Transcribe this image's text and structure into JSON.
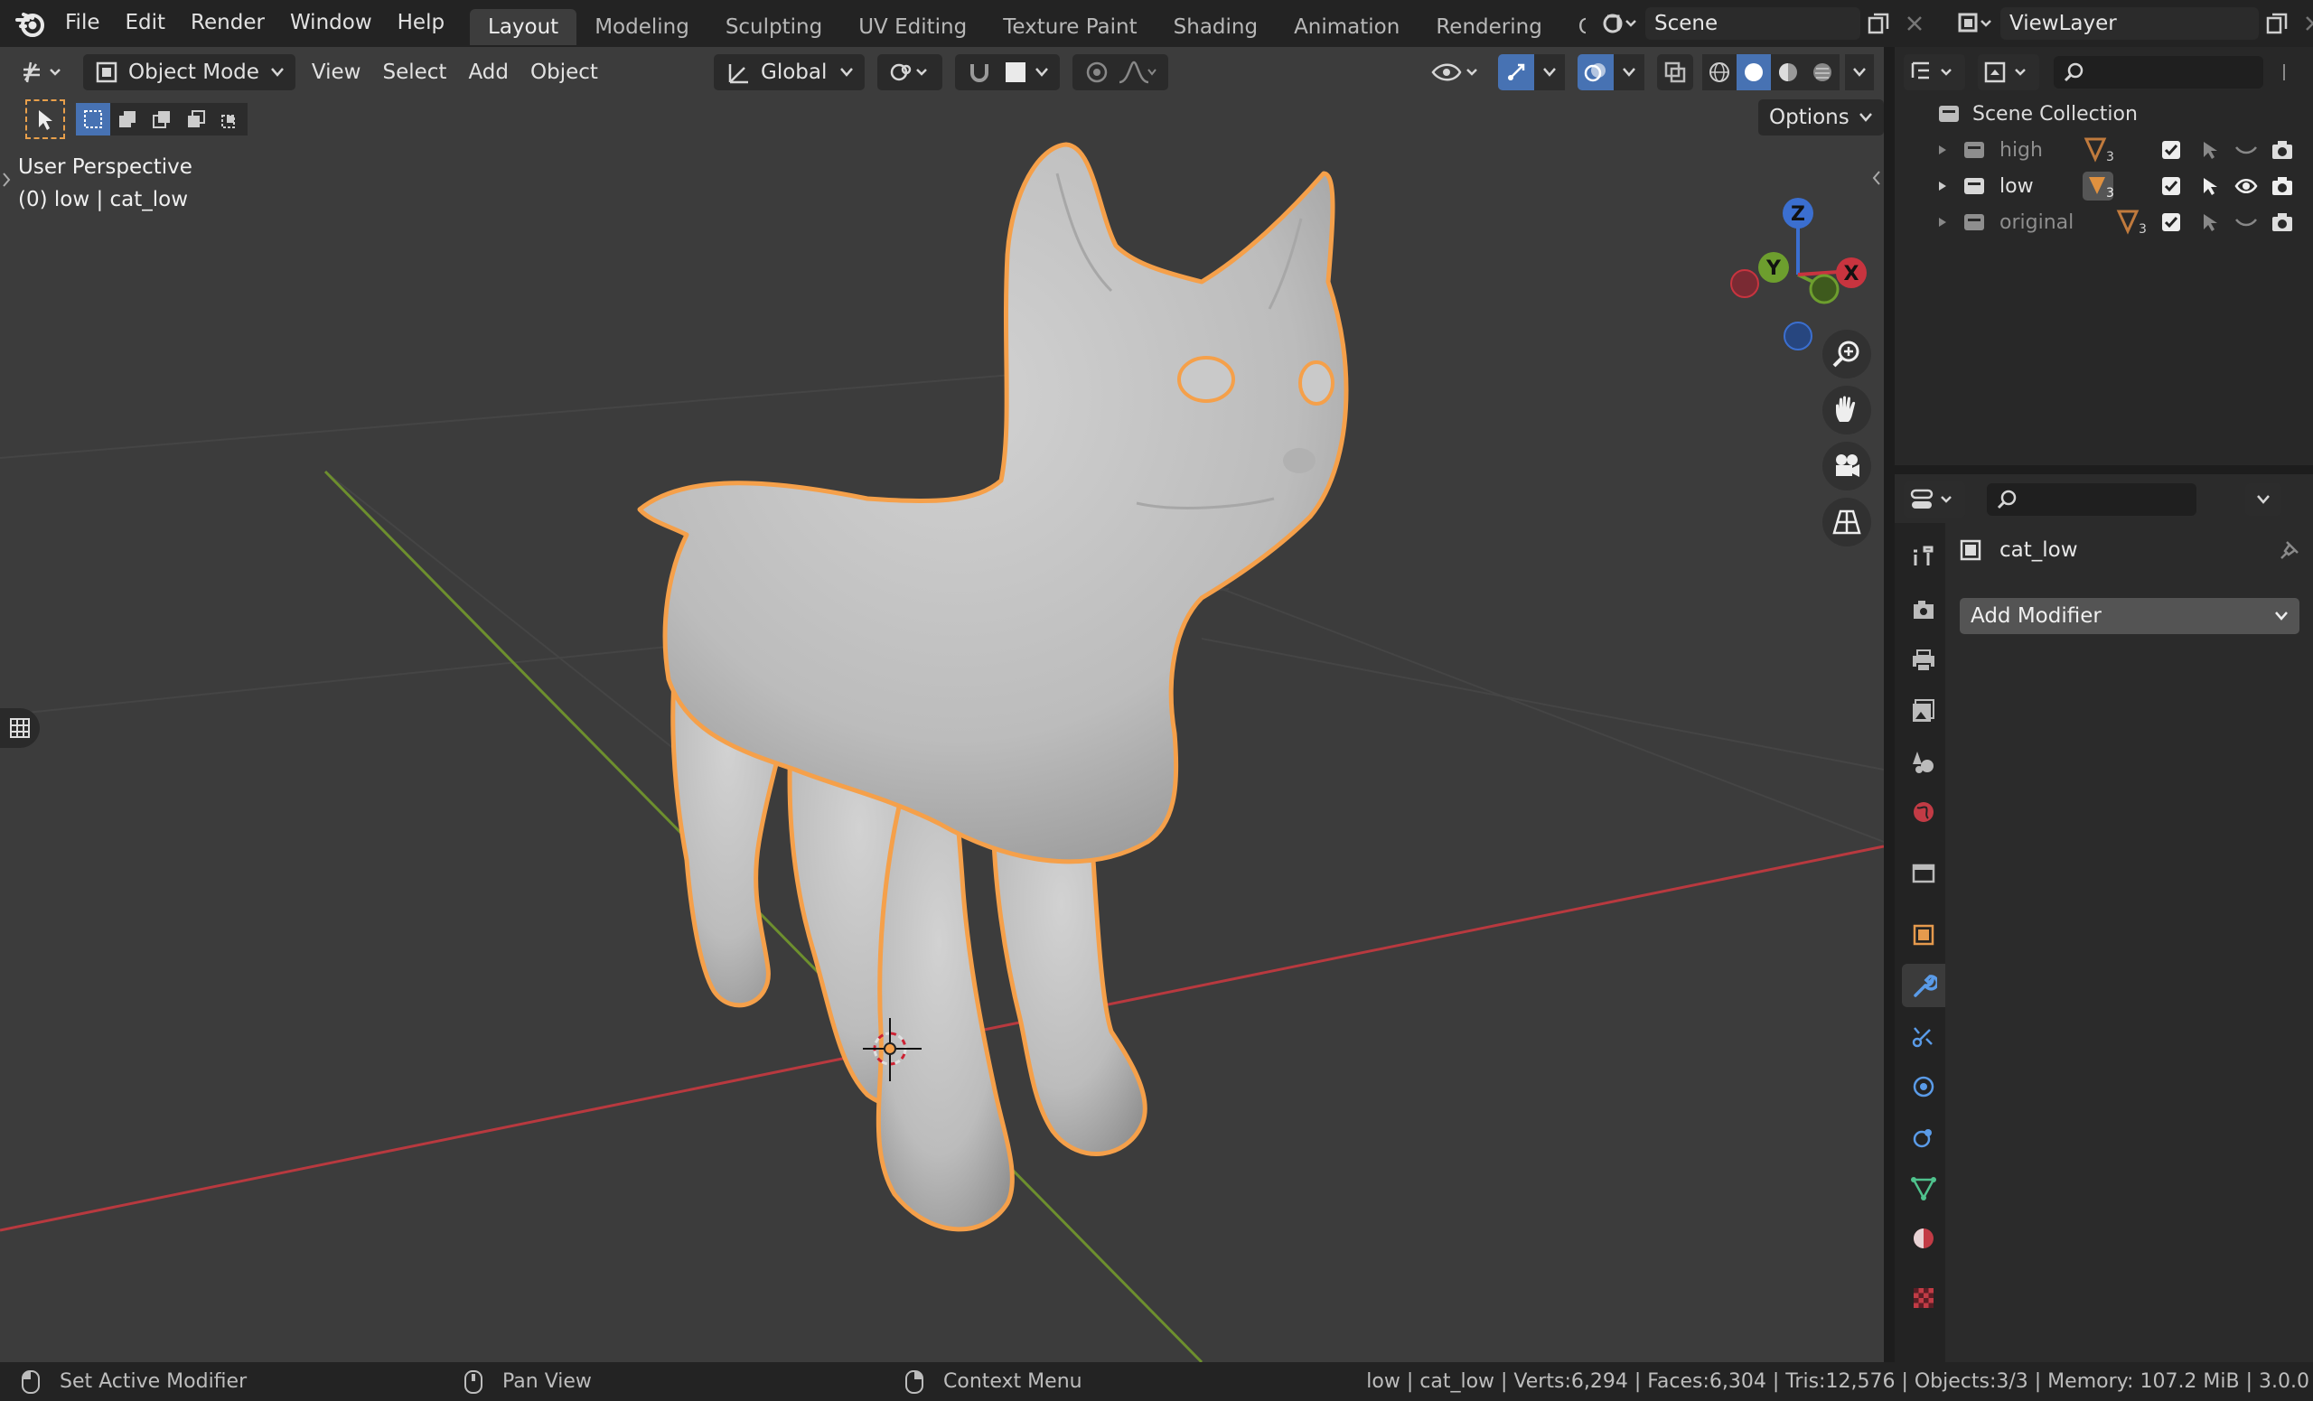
{
  "topbar": {
    "menu": [
      "File",
      "Edit",
      "Render",
      "Window",
      "Help"
    ],
    "workspaces": [
      "Layout",
      "Modeling",
      "Sculpting",
      "UV Editing",
      "Texture Paint",
      "Shading",
      "Animation",
      "Rendering",
      "Compo"
    ],
    "active_workspace": "Layout",
    "scene": "Scene",
    "view_layer": "ViewLayer"
  },
  "viewport": {
    "mode": "Object Mode",
    "menus": [
      "View",
      "Select",
      "Add",
      "Object"
    ],
    "orientation": "Global",
    "options_label": "Options",
    "perspective_label": "User Perspective",
    "context_label": "(0) low | cat_low",
    "gizmo": {
      "z": "Z",
      "y": "Y",
      "x": "X"
    },
    "colors": {
      "selection_outline": "#f5a04a",
      "x_axis": "#b8393f",
      "y_axis": "#6d8f2e",
      "mesh": "#bdbdbd"
    }
  },
  "outliner": {
    "root": "Scene Collection",
    "collections": [
      {
        "name": "high",
        "count": "3",
        "visible": false
      },
      {
        "name": "low",
        "count": "3",
        "visible": true
      },
      {
        "name": "original",
        "count": "3",
        "visible": false
      }
    ]
  },
  "properties": {
    "object_name": "cat_low",
    "add_modifier": "Add Modifier",
    "tabs": [
      "tool",
      "render",
      "output",
      "view-layer",
      "scene",
      "world",
      "collection",
      "object",
      "modifier",
      "particles",
      "physics",
      "constraints",
      "data",
      "material",
      "texture"
    ],
    "active_tab": "modifier"
  },
  "statusbar": {
    "left_hint": "Set Active Modifier",
    "middle_hint": "Pan View",
    "right_hint": "Context Menu",
    "stats": "low | cat_low | Verts:6,294 | Faces:6,304 | Tris:12,576 | Objects:3/3 | Memory: 107.2 MiB | 3.0.0"
  }
}
